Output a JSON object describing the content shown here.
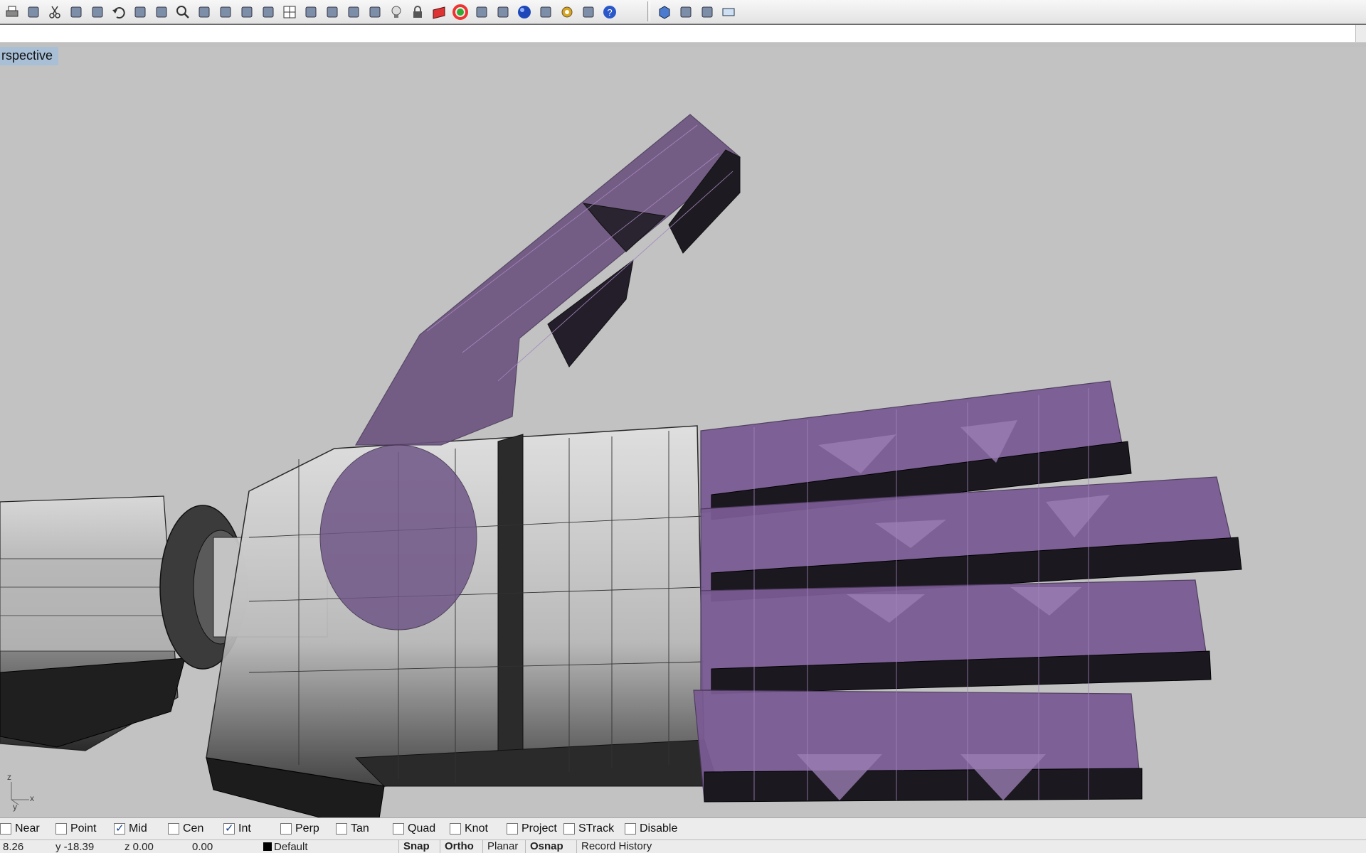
{
  "toolbar": {
    "icons": [
      "print-icon",
      "new-document-icon",
      "cut-icon",
      "copy-icon",
      "paste-icon",
      "undo-icon",
      "pan-hand-icon",
      "rotate-view-icon",
      "zoom-icon",
      "zoom-window-icon",
      "zoom-extents-icon",
      "zoom-selected-icon",
      "undo-view-icon",
      "four-viewports-icon",
      "car-render-icon",
      "shade-icon",
      "circle-select-icon",
      "sphere-icon",
      "light-bulb-icon",
      "lock-icon",
      "layer-icon",
      "color-wheel-icon",
      "sphere-wireframe-icon",
      "mesh-sphere-icon",
      "render-sphere-icon",
      "flag-icon",
      "gear-settings-icon",
      "hierarchy-icon",
      "help-icon"
    ],
    "right_icons": [
      "box-view-icon",
      "viewport-layout-icon",
      "vertical-dots-icon",
      "window-icon"
    ]
  },
  "command": {
    "value": ""
  },
  "viewport": {
    "title": "rspective"
  },
  "axis": {
    "z": "z",
    "x": "x",
    "y": "y"
  },
  "osnap": [
    {
      "label": "Near",
      "checked": false
    },
    {
      "label": "Point",
      "checked": false
    },
    {
      "label": "Mid",
      "checked": true
    },
    {
      "label": "Cen",
      "checked": false
    },
    {
      "label": "Int",
      "checked": true
    },
    {
      "label": "Perp",
      "checked": false
    },
    {
      "label": "Tan",
      "checked": false
    },
    {
      "label": "Quad",
      "checked": false
    },
    {
      "label": "Knot",
      "checked": false
    },
    {
      "label": "Project",
      "checked": false
    },
    {
      "label": "STrack",
      "checked": false
    },
    {
      "label": "Disable",
      "checked": false
    }
  ],
  "status": {
    "x": "8.26",
    "y": "y -18.39",
    "z": "z 0.00",
    "d": "0.00",
    "layer": "Default",
    "buttons": [
      {
        "label": "Snap",
        "bold": true
      },
      {
        "label": "Ortho",
        "bold": true
      },
      {
        "label": "Planar",
        "bold": false
      },
      {
        "label": "Osnap",
        "bold": true
      },
      {
        "label": "Record History",
        "bold": false
      }
    ]
  },
  "colors": {
    "purple": "#7a5b93",
    "viewport_bg": "#c2c2c2",
    "title_bg": "#a8bfd6"
  }
}
